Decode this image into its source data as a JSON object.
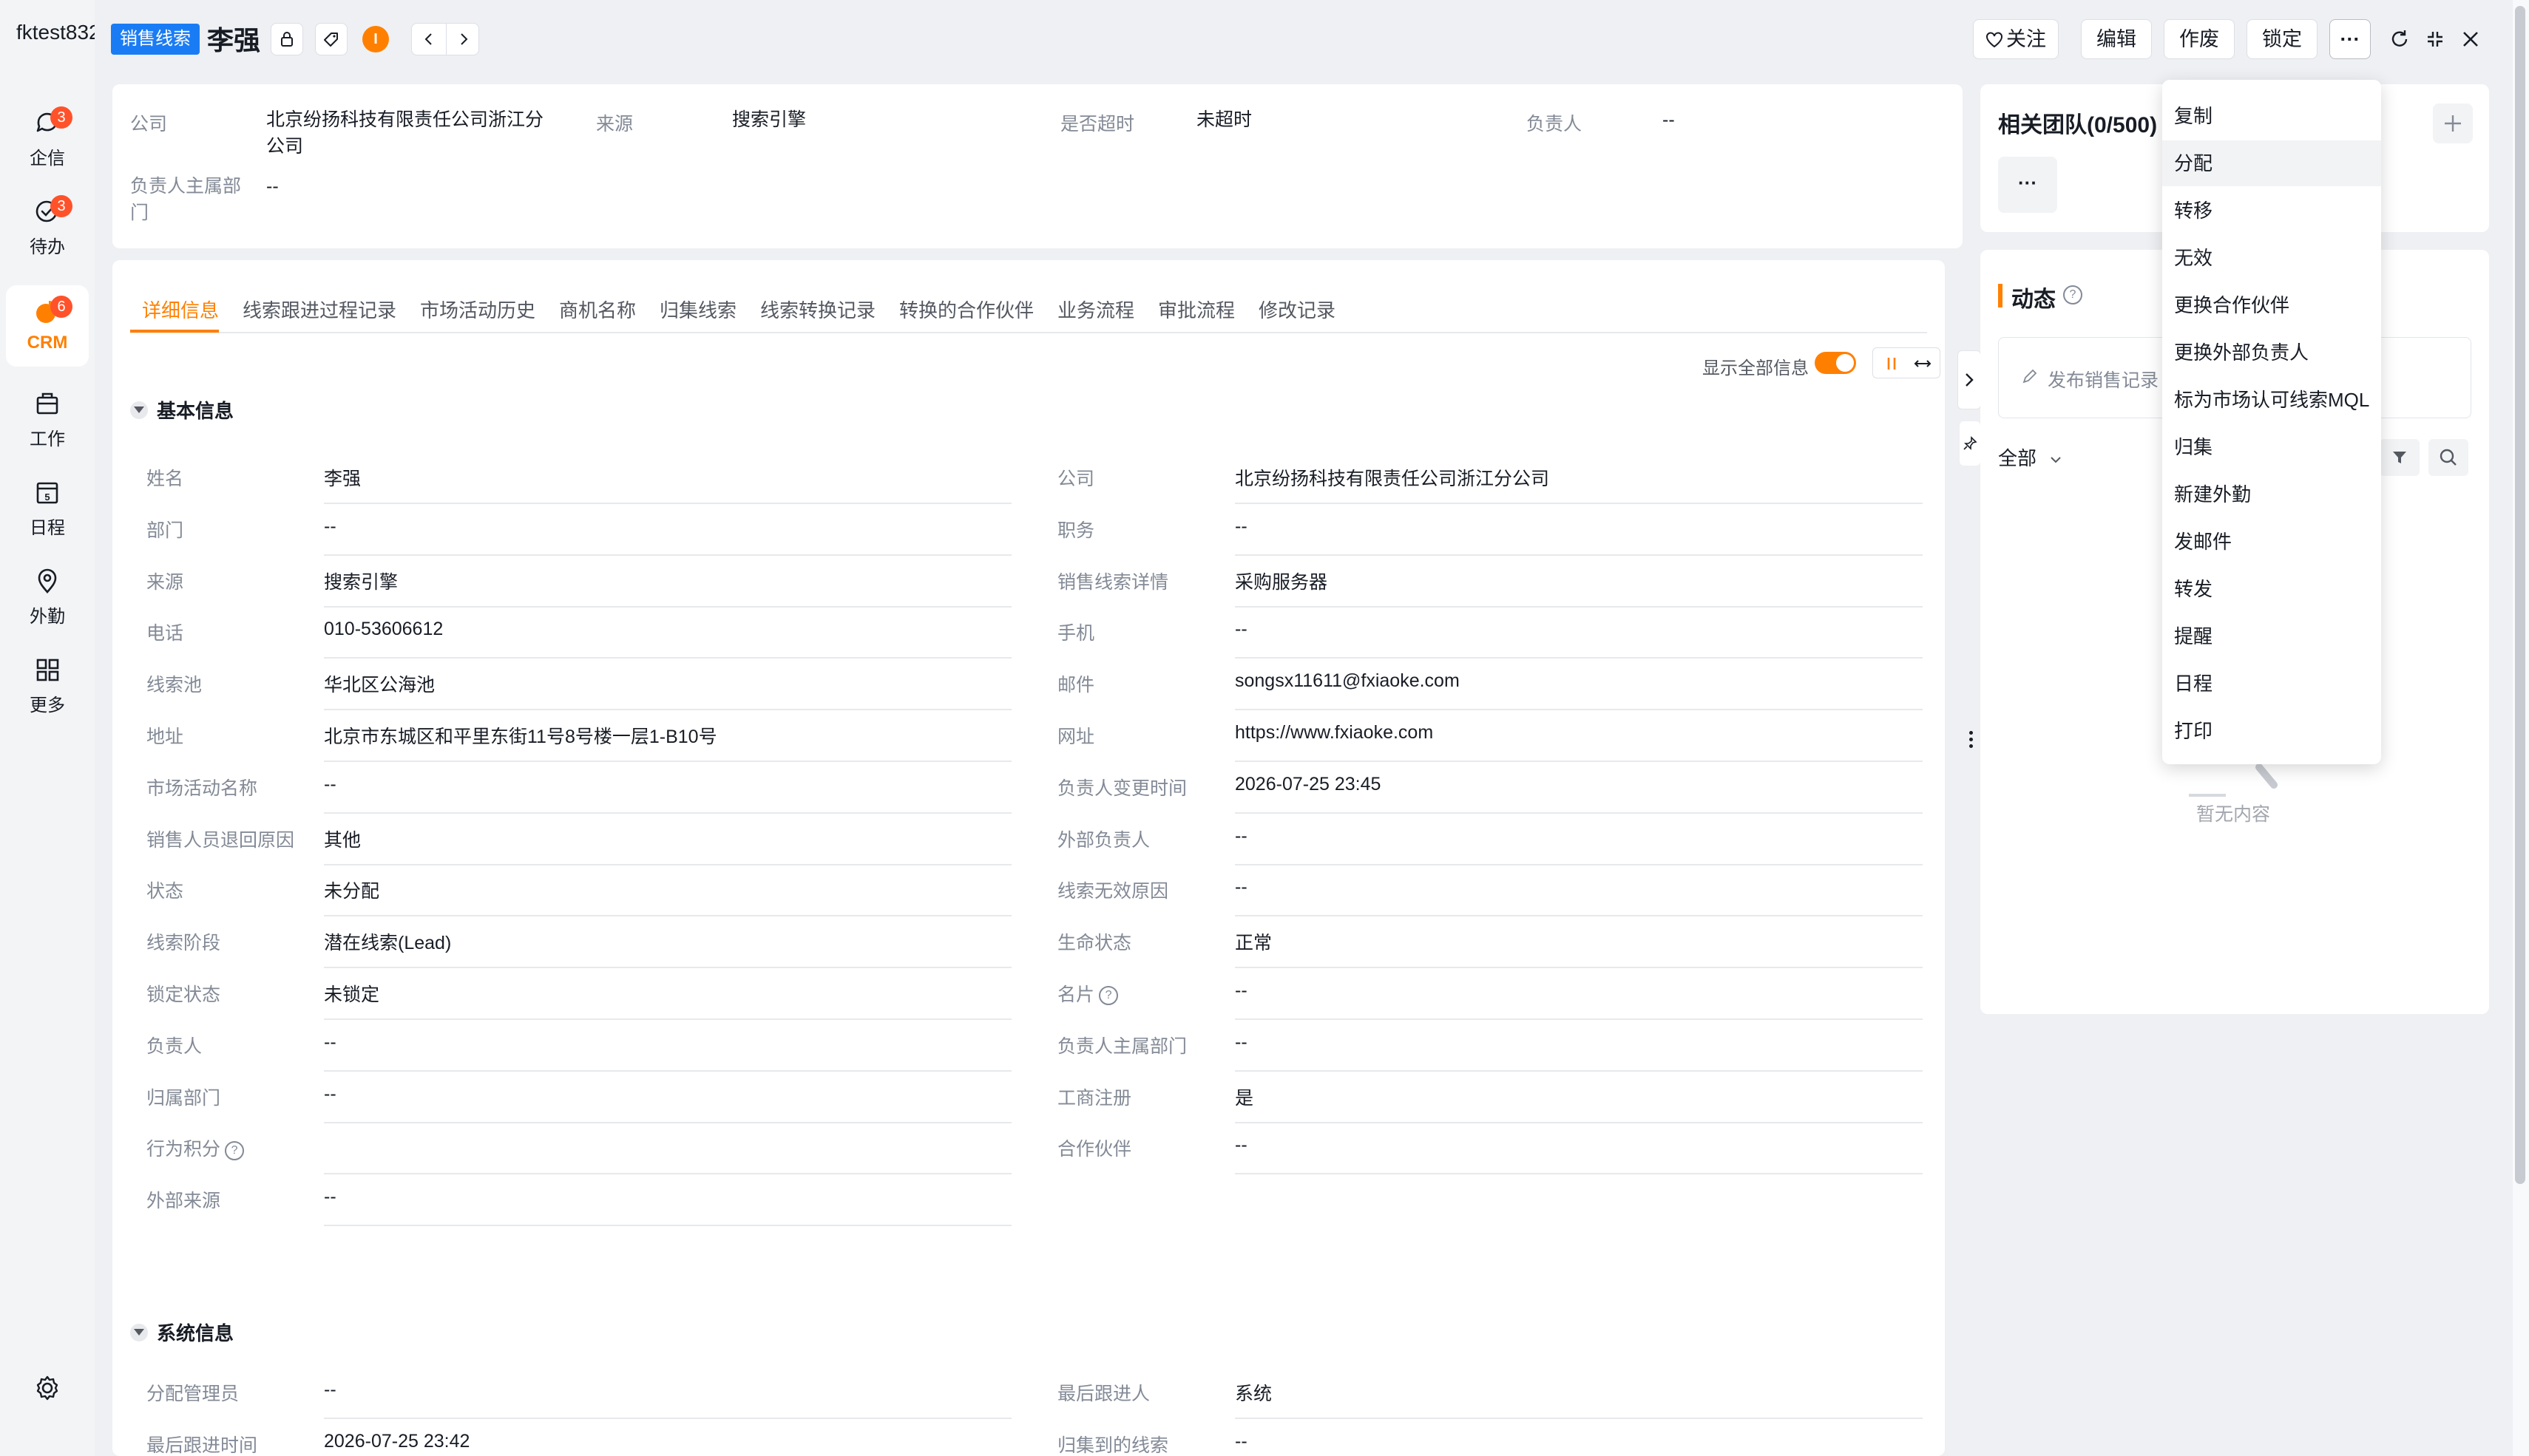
{
  "app": {
    "tenant": "fktest832"
  },
  "nav": {
    "items": [
      {
        "label": "企信",
        "badge": "3",
        "icon": "chat-icon"
      },
      {
        "label": "待办",
        "badge": "3",
        "icon": "todo-check-icon"
      },
      {
        "label": "CRM",
        "badge": "6",
        "icon": "crm-pie-icon",
        "active": true
      },
      {
        "label": "工作",
        "badge": "",
        "icon": "briefcase-icon"
      },
      {
        "label": "日程",
        "badge": "",
        "icon": "calendar-icon",
        "calendar_day": "5"
      },
      {
        "label": "外勤",
        "badge": "",
        "icon": "location-pin-icon"
      },
      {
        "label": "更多",
        "badge": "",
        "icon": "grid-icon"
      }
    ],
    "settings_icon": "settings-gear-icon"
  },
  "header": {
    "tag": "销售线索",
    "title": "李强",
    "avatar_letter": "I",
    "buttons": {
      "follow": "关注",
      "edit": "编辑",
      "void": "作废",
      "lock": "锁定",
      "more": "···"
    }
  },
  "summary": {
    "fields": [
      {
        "label": "公司",
        "value": "北京纷扬科技有限责任公司浙江分公司"
      },
      {
        "label": "来源",
        "value": "搜索引擎"
      },
      {
        "label": "是否超时",
        "value": "未超时"
      },
      {
        "label": "负责人",
        "value": "--"
      },
      {
        "label": "负责人主属部门",
        "value": "--"
      }
    ]
  },
  "tabs": [
    "详细信息",
    "线索跟进过程记录",
    "市场活动历史",
    "商机名称",
    "归集线索",
    "线索转换记录",
    "转换的合作伙伴",
    "业务流程",
    "审批流程",
    "修改记录"
  ],
  "detail": {
    "show_all_label": "显示全部信息",
    "show_all_on": true,
    "basic": {
      "title": "基本信息",
      "left": [
        {
          "label": "姓名",
          "value": "李强"
        },
        {
          "label": "部门",
          "value": "--"
        },
        {
          "label": "来源",
          "value": "搜索引擎"
        },
        {
          "label": "电话",
          "value": "010-53606612"
        },
        {
          "label": "线索池",
          "value": "华北区公海池"
        },
        {
          "label": "地址",
          "value": "北京市东城区和平里东街11号8号楼一层1-B10号"
        },
        {
          "label": "市场活动名称",
          "value": "--"
        },
        {
          "label": "销售人员退回原因",
          "value": "其他"
        },
        {
          "label": "状态",
          "value": "未分配"
        },
        {
          "label": "线索阶段",
          "value": "潜在线索(Lead)"
        },
        {
          "label": "锁定状态",
          "value": "未锁定"
        },
        {
          "label": "负责人",
          "value": "--"
        },
        {
          "label": "归属部门",
          "value": "--"
        },
        {
          "label": "行为积分",
          "value": "",
          "help": true
        },
        {
          "label": "外部来源",
          "value": "--"
        }
      ],
      "right": [
        {
          "label": "公司",
          "value": "北京纷扬科技有限责任公司浙江分公司"
        },
        {
          "label": "职务",
          "value": "--"
        },
        {
          "label": "销售线索详情",
          "value": "采购服务器"
        },
        {
          "label": "手机",
          "value": "--"
        },
        {
          "label": "邮件",
          "value": "songsx11611@fxiaoke.com"
        },
        {
          "label": "网址",
          "value": "https://www.fxiaoke.com"
        },
        {
          "label": "负责人变更时间",
          "value": "2026-07-25 23:45"
        },
        {
          "label": "外部负责人",
          "value": "--"
        },
        {
          "label": "线索无效原因",
          "value": "--"
        },
        {
          "label": "生命状态",
          "value": "正常"
        },
        {
          "label": "名片",
          "value": "--",
          "help": true
        },
        {
          "label": "负责人主属部门",
          "value": "--"
        },
        {
          "label": "工商注册",
          "value": "是"
        },
        {
          "label": "合作伙伴",
          "value": "--"
        }
      ]
    },
    "system": {
      "title": "系统信息",
      "left": [
        {
          "label": "分配管理员",
          "value": "--"
        },
        {
          "label": "最后跟进时间",
          "value": "2026-07-25 23:42"
        }
      ],
      "right": [
        {
          "label": "最后跟进人",
          "value": "系统"
        },
        {
          "label": "归集到的线索",
          "value": "--"
        }
      ]
    }
  },
  "team": {
    "title": "相关团队(0/500)",
    "more": "···"
  },
  "activity": {
    "title": "动态",
    "publish_placeholder": "发布销售记录",
    "filter_label": "全部",
    "empty_text": "暂无内容"
  },
  "menu": {
    "items": [
      "复制",
      "分配",
      "转移",
      "无效",
      "更换合作伙伴",
      "更换外部负责人",
      "标为市场认可线索MQL",
      "归集",
      "新建外勤",
      "发邮件",
      "转发",
      "提醒",
      "日程",
      "打印"
    ],
    "hovered": "分配"
  },
  "colors": {
    "accent": "#ff8000",
    "tag": "#1a7cf5",
    "badge": "#ff522a"
  }
}
